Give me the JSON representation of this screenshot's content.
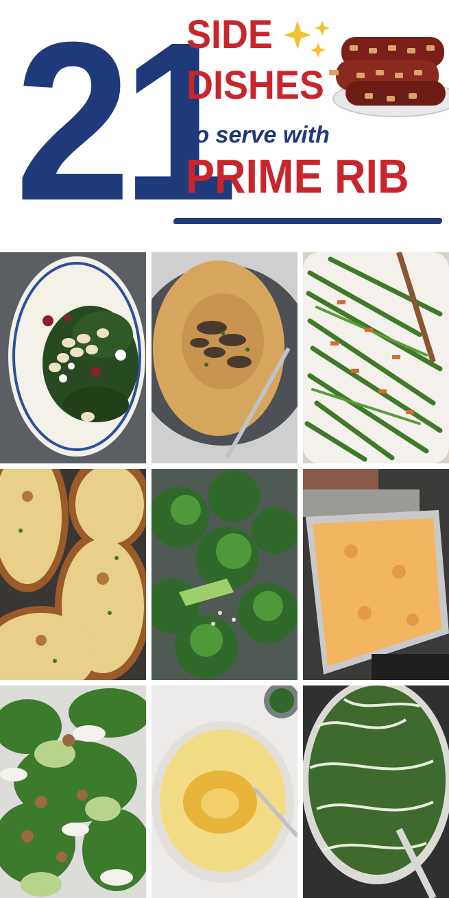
{
  "header": {
    "number": "21",
    "line1": "SIDE",
    "line2": "DISHES",
    "line3": "to serve with",
    "line4": "PRIME RIB"
  },
  "colors": {
    "navy": "#1f3a7a",
    "red": "#c8262c"
  },
  "photos": [
    "white-bean-spinach-salad-photo",
    "mushroom-risotto-photo",
    "green-beans-almondine-photo",
    "twice-baked-potatoes-photo",
    "roasted-broccoli-photo",
    "baked-mac-and-cheese-photo",
    "walnut-green-salad-photo",
    "mashed-potatoes-photo",
    "creamed-spinach-photo"
  ]
}
